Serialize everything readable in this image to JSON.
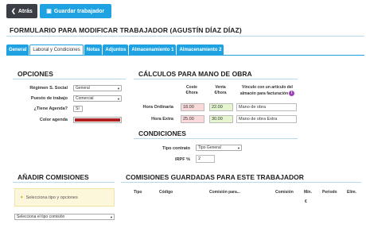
{
  "toolbar": {
    "back_label": "Atrás",
    "save_label": "Guardar trabajador"
  },
  "page_title": "FORMULARIO PARA MODIFICAR TRABAJADOR (AGUSTÍN DÍAZ DÍAZ)",
  "tabs": [
    {
      "label": "General",
      "active": false
    },
    {
      "label": "Laboral y Condiciones",
      "active": true
    },
    {
      "label": "Notas",
      "active": false
    },
    {
      "label": "Adjuntos",
      "active": false
    },
    {
      "label": "Almacenamiento 1",
      "active": false
    },
    {
      "label": "Almacenamiento 2",
      "active": false
    }
  ],
  "opciones": {
    "title": "OPCIONES",
    "regimen_label": "Régimen S. Social",
    "regimen_value": "General",
    "puesto_label": "Puesto de trabajo",
    "puesto_value": "Comercial",
    "agenda_label": "¿Tiene Agenda?",
    "agenda_value": "Sí",
    "color_label": "Color agenda",
    "color_value": "#b02020"
  },
  "calculos": {
    "title": "CÁLCULOS PARA MANO DE OBRA",
    "col_coste": "Coste",
    "col_coste_unit": "€/hora",
    "col_venta": "Venta",
    "col_venta_unit": "€/hora",
    "col_vinculo_1": "Vínculo con un artículo del",
    "col_vinculo_2": "almacén para facturación",
    "info_icon": "i",
    "rows": [
      {
        "label": "Hora Ordinaria",
        "coste": "18.00",
        "venta": "22.00",
        "articulo": "Mano de obra"
      },
      {
        "label": "Hora Extra",
        "coste": "25.00",
        "venta": "30.00",
        "articulo": "Mano de obra Extra"
      }
    ]
  },
  "condiciones": {
    "title": "CONDICIONES",
    "contrato_label": "Tipo contrato",
    "contrato_value": "Tipo General",
    "irpf_label": "IRPF %",
    "irpf_value": "2"
  },
  "comisiones": {
    "title": "AÑADIR COMISIONES",
    "notice": "Selecciona tipo y opciones",
    "select_placeholder": "Selecciona el tipo comisión"
  },
  "guardadas": {
    "title": "COMISIONES GUARDADAS PARA ESTE TRABAJADOR",
    "headers": [
      "Tipo",
      "Código",
      "Comisión para...",
      "Comisión",
      "Mín.",
      "Periodo",
      "Elim."
    ],
    "unit": "€"
  },
  "colors": {
    "accent": "#1fa2e2",
    "dark_button": "#3b3f45",
    "coste_bg": "#f9d9d9",
    "venta_bg": "#e4f5cf",
    "notice_bg": "#fcf6db"
  }
}
